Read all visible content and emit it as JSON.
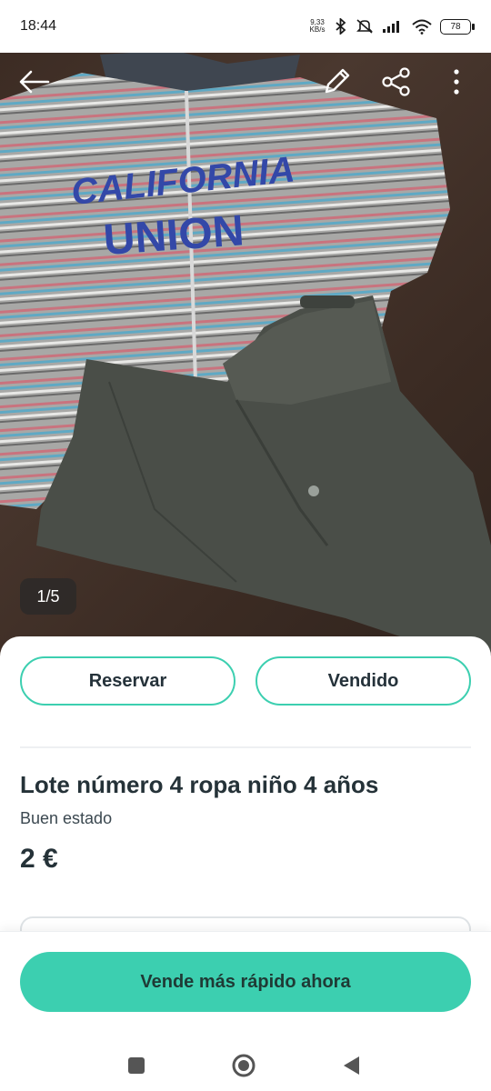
{
  "status_bar": {
    "time": "18:44",
    "net_speed_value": "9,33",
    "net_speed_unit": "KB/s",
    "battery": "78"
  },
  "photo": {
    "counter": "1/5",
    "print_line1": "CALIFORNIA",
    "print_line2": "UNION",
    "colors": {
      "sweater": "#a7a7a4",
      "pants": "#4a4e48",
      "table": "#3a2a22",
      "print": "#3348a8"
    }
  },
  "actions": {
    "reserve_label": "Reservar",
    "sold_label": "Vendido"
  },
  "product": {
    "title": "Lote número 4 ropa niño 4 años",
    "condition": "Buen estado",
    "price": "2 €"
  },
  "cta": {
    "label": "Vende más rápido ahora"
  },
  "theme": {
    "accent": "#3ccfb0",
    "text": "#253238"
  },
  "icons": {
    "back": "arrow-left-icon",
    "edit": "pencil-icon",
    "share": "share-icon",
    "more": "more-vertical-icon",
    "nav_recent": "square-icon",
    "nav_home": "circle-icon",
    "nav_back": "triangle-icon"
  }
}
